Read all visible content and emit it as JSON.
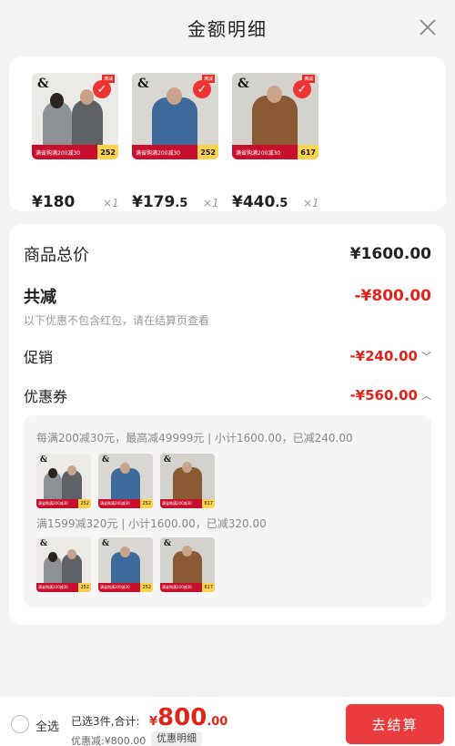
{
  "header": {
    "title": "金额明细"
  },
  "products": [
    {
      "price_int": "¥180",
      "price_dec": "",
      "qty": "×1",
      "banner_text": "满省购满200减30",
      "banner_price": "252",
      "tag": "满减"
    },
    {
      "price_int": "¥179",
      "price_dec": ".5",
      "qty": "×1",
      "banner_text": "满省购满200减30",
      "banner_price": "252",
      "tag": "满减"
    },
    {
      "price_int": "¥440",
      "price_dec": ".5",
      "qty": "×1",
      "banner_text": "满省购满200减30",
      "banner_price": "617",
      "tag": "满减"
    }
  ],
  "summary": {
    "goods_total_label": "商品总价",
    "goods_total_value": "¥1600.00",
    "discount_label": "共减",
    "discount_value": "-¥800.00",
    "discount_note": "以下优惠不包含红包，请在结算页查看",
    "promo_label": "促销",
    "promo_value": "-¥240.00",
    "coupon_label": "优惠券",
    "coupon_value": "-¥560.00",
    "coupon_rule_1": "每满200减30元，最高减49999元 | 小计1600.00，已减240.00",
    "coupon_rule_2": "满1599减320元 | 小计1600.00，已减320.00"
  },
  "footer": {
    "select_all": "全选",
    "selected": "已选3件,合计:",
    "total_currency": "¥",
    "total_int": "800",
    "total_dec": ".00",
    "saved": "优惠减:¥800.00",
    "detail_button": "优惠明细",
    "checkout_button": "去结算"
  },
  "colors": {
    "accent": "#e2231a",
    "checkout": "#ea3c3c",
    "banner": "#c8102e"
  }
}
